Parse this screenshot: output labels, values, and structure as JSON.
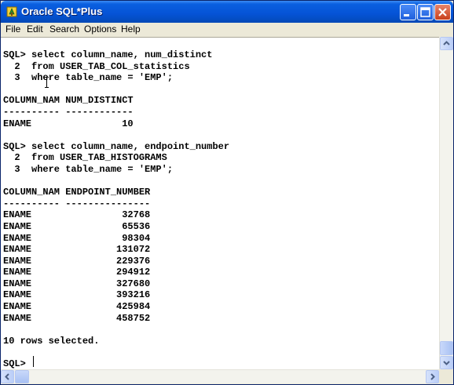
{
  "window": {
    "title": "Oracle SQL*Plus",
    "accent_color": "#0553d6",
    "icons": [
      "sqlplus-app-icon",
      "minimize-icon",
      "maximize-icon",
      "close-icon"
    ]
  },
  "menu": [
    "File",
    "Edit",
    "Search",
    "Options",
    "Help"
  ],
  "console": {
    "lines": [
      "SQL> select column_name, num_distinct",
      "  2  from USER_TAB_COL_statistics",
      "  3  where table_name = 'EMP';",
      "",
      "COLUMN_NAM NUM_DISTINCT",
      "---------- ------------",
      "ENAME                10",
      "",
      "SQL> select column_name, endpoint_number",
      "  2  from USER_TAB_HISTOGRAMS",
      "  3  where table_name = 'EMP';",
      "",
      "COLUMN_NAM ENDPOINT_NUMBER",
      "---------- ---------------",
      "ENAME                32768",
      "ENAME                65536",
      "ENAME                98304",
      "ENAME               131072",
      "ENAME               229376",
      "ENAME               294912",
      "ENAME               327680",
      "ENAME               393216",
      "ENAME               425984",
      "ENAME               458752",
      "",
      "10 rows selected.",
      "",
      "SQL> "
    ]
  }
}
